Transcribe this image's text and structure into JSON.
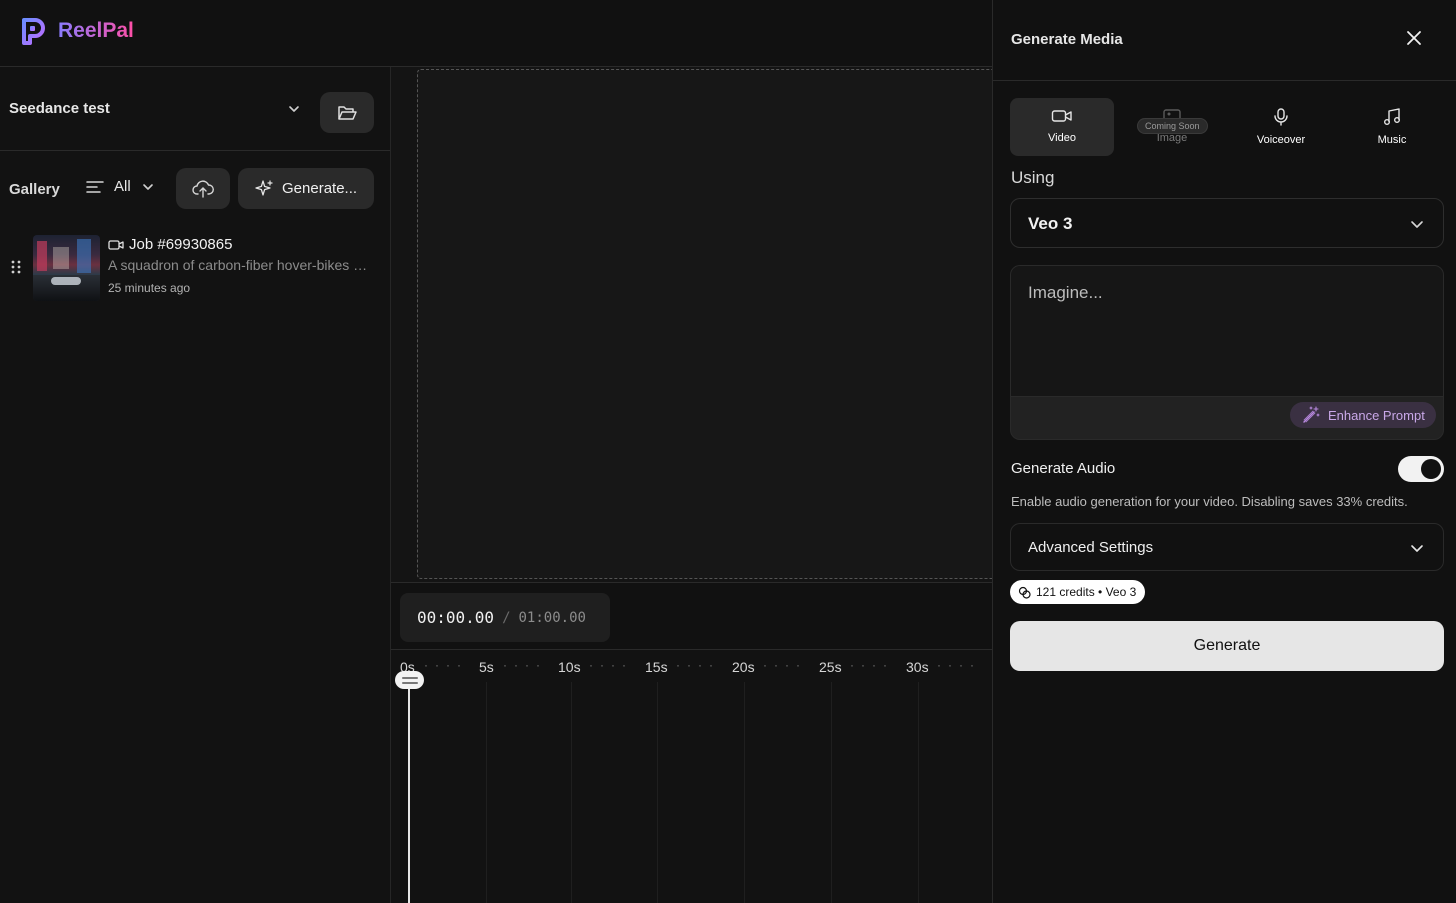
{
  "app": {
    "name": "ReelPal",
    "brand_colors": [
      "#8a7cff",
      "#ff4fa6"
    ]
  },
  "sidebar": {
    "project_name": "Seedance test",
    "gallery_label": "Gallery",
    "filter_label": "All",
    "generate_label": "Generate...",
    "jobs": [
      {
        "title": "Job #69930865",
        "description": "A squadron of carbon-fiber hover-bikes weaving through neon streets",
        "time": "25 minutes ago",
        "type_icon": "video-icon"
      }
    ]
  },
  "playback": {
    "current_time": "00:00.00",
    "separator": "/",
    "total_time": "01:00.00"
  },
  "timeline": {
    "ticks": [
      "0s",
      "5s",
      "10s",
      "15s",
      "20s",
      "25s",
      "30s"
    ],
    "playhead_position_s": 0
  },
  "panel": {
    "title": "Generate Media",
    "tabs": [
      {
        "label": "Video",
        "icon": "video-icon",
        "active": true
      },
      {
        "label": "Image",
        "icon": "image-icon",
        "badge": "Coming Soon",
        "disabled": true
      },
      {
        "label": "Voiceover",
        "icon": "microphone-icon"
      },
      {
        "label": "Music",
        "icon": "music-note-icon"
      }
    ],
    "using_label": "Using",
    "model": "Veo 3",
    "prompt_placeholder": "Imagine...",
    "enhance_label": "Enhance Prompt",
    "audio_label": "Generate Audio",
    "audio_enabled": true,
    "audio_description": "Enable audio generation for your video. Disabling saves 33% credits.",
    "advanced_label": "Advanced Settings",
    "credits_label": "121 credits • Veo 3",
    "generate_label": "Generate"
  }
}
